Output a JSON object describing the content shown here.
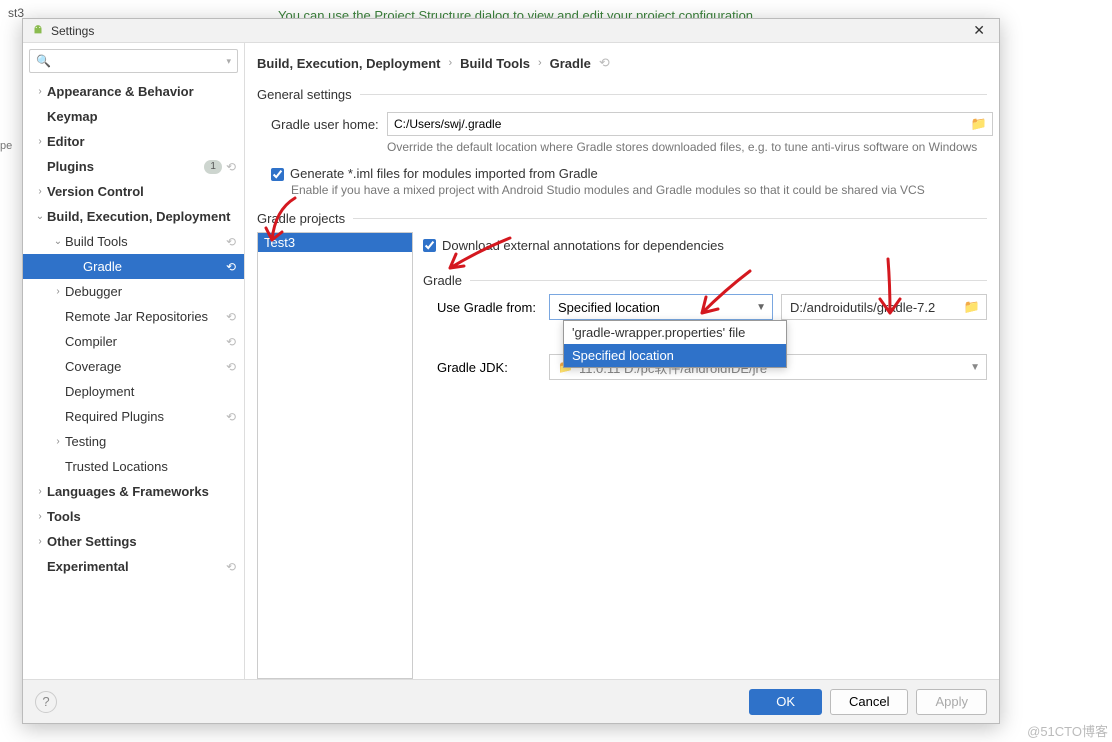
{
  "background": {
    "tab": "st3",
    "hint": "You can use the Project Structure dialog to view and edit your project configuration",
    "leftTab": "pe"
  },
  "dialog": {
    "title": "Settings",
    "searchPlaceholder": ""
  },
  "tree": [
    {
      "label": "Appearance & Behavior",
      "indent": 0,
      "arrow": "›",
      "bold": true
    },
    {
      "label": "Keymap",
      "indent": 0,
      "arrow": "",
      "bold": true
    },
    {
      "label": "Editor",
      "indent": 0,
      "arrow": "›",
      "bold": true
    },
    {
      "label": "Plugins",
      "indent": 0,
      "arrow": "",
      "bold": true,
      "badge": "1",
      "rollback": true
    },
    {
      "label": "Version Control",
      "indent": 0,
      "arrow": "›",
      "bold": true
    },
    {
      "label": "Build, Execution, Deployment",
      "indent": 0,
      "arrow": "⌄",
      "bold": true
    },
    {
      "label": "Build Tools",
      "indent": 1,
      "arrow": "⌄",
      "bold": false,
      "rollback": true
    },
    {
      "label": "Gradle",
      "indent": 2,
      "arrow": "",
      "bold": false,
      "selected": true,
      "rollback": true
    },
    {
      "label": "Debugger",
      "indent": 1,
      "arrow": "›",
      "bold": false
    },
    {
      "label": "Remote Jar Repositories",
      "indent": 1,
      "arrow": "",
      "bold": false,
      "rollback": true
    },
    {
      "label": "Compiler",
      "indent": 1,
      "arrow": "",
      "bold": false,
      "rollback": true
    },
    {
      "label": "Coverage",
      "indent": 1,
      "arrow": "",
      "bold": false,
      "rollback": true
    },
    {
      "label": "Deployment",
      "indent": 1,
      "arrow": "",
      "bold": false
    },
    {
      "label": "Required Plugins",
      "indent": 1,
      "arrow": "",
      "bold": false,
      "rollback": true
    },
    {
      "label": "Testing",
      "indent": 1,
      "arrow": "›",
      "bold": false
    },
    {
      "label": "Trusted Locations",
      "indent": 1,
      "arrow": "",
      "bold": false
    },
    {
      "label": "Languages & Frameworks",
      "indent": 0,
      "arrow": "›",
      "bold": true
    },
    {
      "label": "Tools",
      "indent": 0,
      "arrow": "›",
      "bold": true
    },
    {
      "label": "Other Settings",
      "indent": 0,
      "arrow": "›",
      "bold": true
    },
    {
      "label": "Experimental",
      "indent": 0,
      "arrow": "",
      "bold": true,
      "rollback": true
    }
  ],
  "breadcrumb": {
    "a": "Build, Execution, Deployment",
    "b": "Build Tools",
    "c": "Gradle"
  },
  "general": {
    "title": "General settings",
    "userHomeLabel": "Gradle user home:",
    "userHomeValue": "C:/Users/swj/.gradle",
    "userHomeHint": "Override the default location where Gradle stores downloaded files, e.g. to tune anti-virus software on Windows",
    "genImlLabel": "Generate *.iml files for modules imported from Gradle",
    "genImlHint": "Enable if you have a mixed project with Android Studio modules and Gradle modules so that it could be shared via VCS"
  },
  "projects": {
    "title": "Gradle projects",
    "list": [
      "Test3"
    ],
    "downloadAnnot": "Download external annotations for dependencies",
    "gradleTitle": "Gradle",
    "useGradleLabel": "Use Gradle from:",
    "useGradleValue": "Specified location",
    "useGradleOptions": [
      "'gradle-wrapper.properties' file",
      "Specified location"
    ],
    "gradlePath": "D:/androidutils/gradle-7.2",
    "jdkLabel": "Gradle JDK:",
    "jdkValue": "11.0.11 D:/pc软件/androidIDE/jre"
  },
  "footer": {
    "ok": "OK",
    "cancel": "Cancel",
    "apply": "Apply"
  },
  "watermark": "@51CTO博客"
}
